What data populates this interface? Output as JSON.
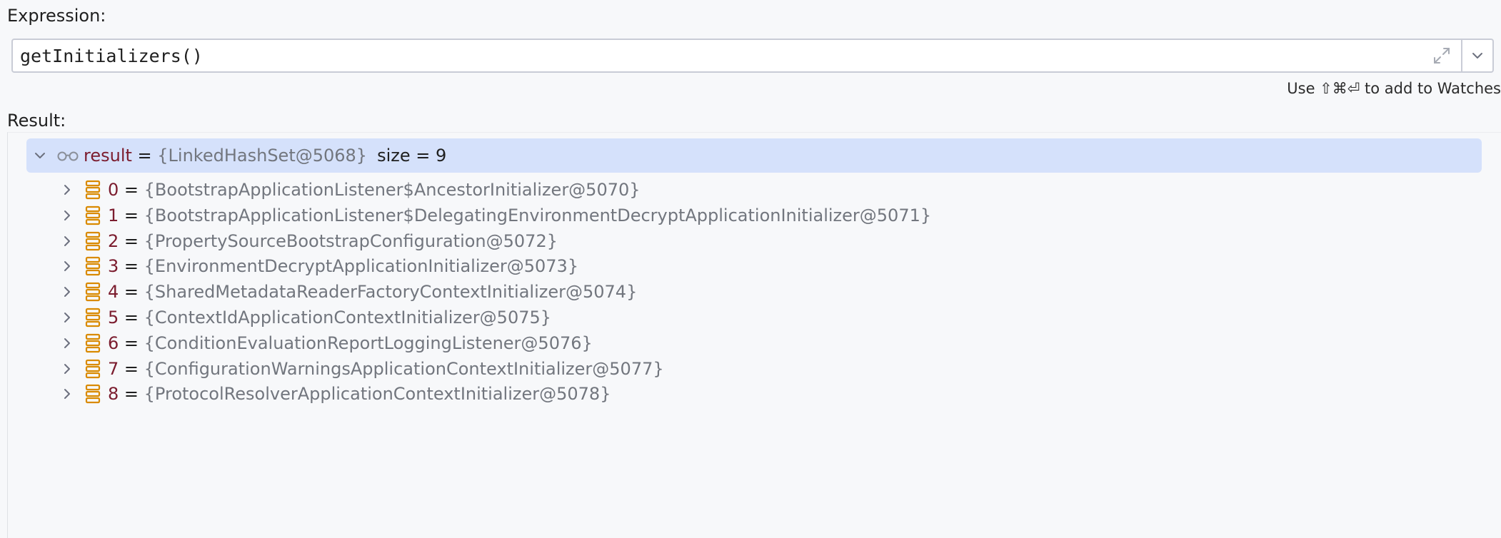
{
  "expression": {
    "label": "Expression:",
    "value": "getInitializers()"
  },
  "hint": "Use ⇧⌘⏎ to add to Watches",
  "result": {
    "label": "Result:",
    "root": {
      "name": "result",
      "eq": " = ",
      "value": "{LinkedHashSet@5068}",
      "size": "size = 9"
    },
    "items": [
      {
        "index": "0",
        "eq": " = ",
        "value": "{BootstrapApplicationListener$AncestorInitializer@5070}"
      },
      {
        "index": "1",
        "eq": " = ",
        "value": "{BootstrapApplicationListener$DelegatingEnvironmentDecryptApplicationInitializer@5071}"
      },
      {
        "index": "2",
        "eq": " = ",
        "value": "{PropertySourceBootstrapConfiguration@5072}"
      },
      {
        "index": "3",
        "eq": " = ",
        "value": "{EnvironmentDecryptApplicationInitializer@5073}"
      },
      {
        "index": "4",
        "eq": " = ",
        "value": "{SharedMetadataReaderFactoryContextInitializer@5074}"
      },
      {
        "index": "5",
        "eq": " = ",
        "value": "{ContextIdApplicationContextInitializer@5075}"
      },
      {
        "index": "6",
        "eq": " = ",
        "value": "{ConditionEvaluationReportLoggingListener@5076}"
      },
      {
        "index": "7",
        "eq": " = ",
        "value": "{ConfigurationWarningsApplicationContextInitializer@5077}"
      },
      {
        "index": "8",
        "eq": " = ",
        "value": "{ProtocolResolverApplicationContextInitializer@5078}"
      }
    ]
  },
  "colors": {
    "selection": "#d5e1fb",
    "name": "#7b1c2e",
    "value": "#72767e",
    "field_icon": "#d98a00"
  },
  "icons": {
    "root": "watch-glasses-icon",
    "item": "field-stack-icon",
    "expand": "expand-editor-icon",
    "dropdown": "chevron-down-icon",
    "tree_open": "chevron-down-icon",
    "tree_closed": "chevron-right-icon"
  }
}
